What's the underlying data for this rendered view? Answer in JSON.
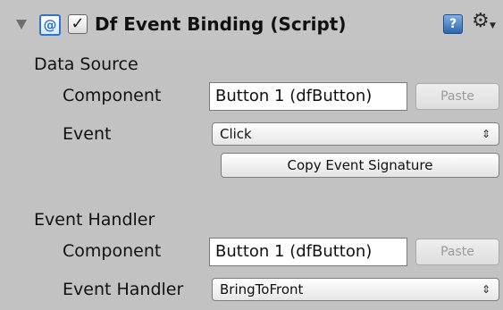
{
  "component": {
    "title": "Df Event Binding (Script)",
    "enabled_glyph": "✓",
    "script_icon_glyph": "@",
    "help_glyph": "?",
    "gear_glyph": "⚙",
    "icons": [
      "foldout-arrow-icon",
      "script-icon",
      "checkbox-icon",
      "help-book-icon",
      "gear-icon"
    ]
  },
  "data_source": {
    "title": "Data Source",
    "component_label": "Component",
    "component_value": "Button 1 (dfButton)",
    "paste_label": "Paste",
    "event_label": "Event",
    "event_value": "Click",
    "copy_button_label": "Copy Event Signature"
  },
  "event_handler": {
    "title": "Event Handler",
    "component_label": "Component",
    "component_value": "Button 1 (dfButton)",
    "paste_label": "Paste",
    "handler_label": "Event Handler",
    "handler_value": "BringToFront"
  },
  "popup_arrows": "⇕",
  "colors": {
    "panel_bg": "#c2c2c2",
    "script_icon_blue": "#2f74c9",
    "disabled_text": "#9a9a9a"
  }
}
